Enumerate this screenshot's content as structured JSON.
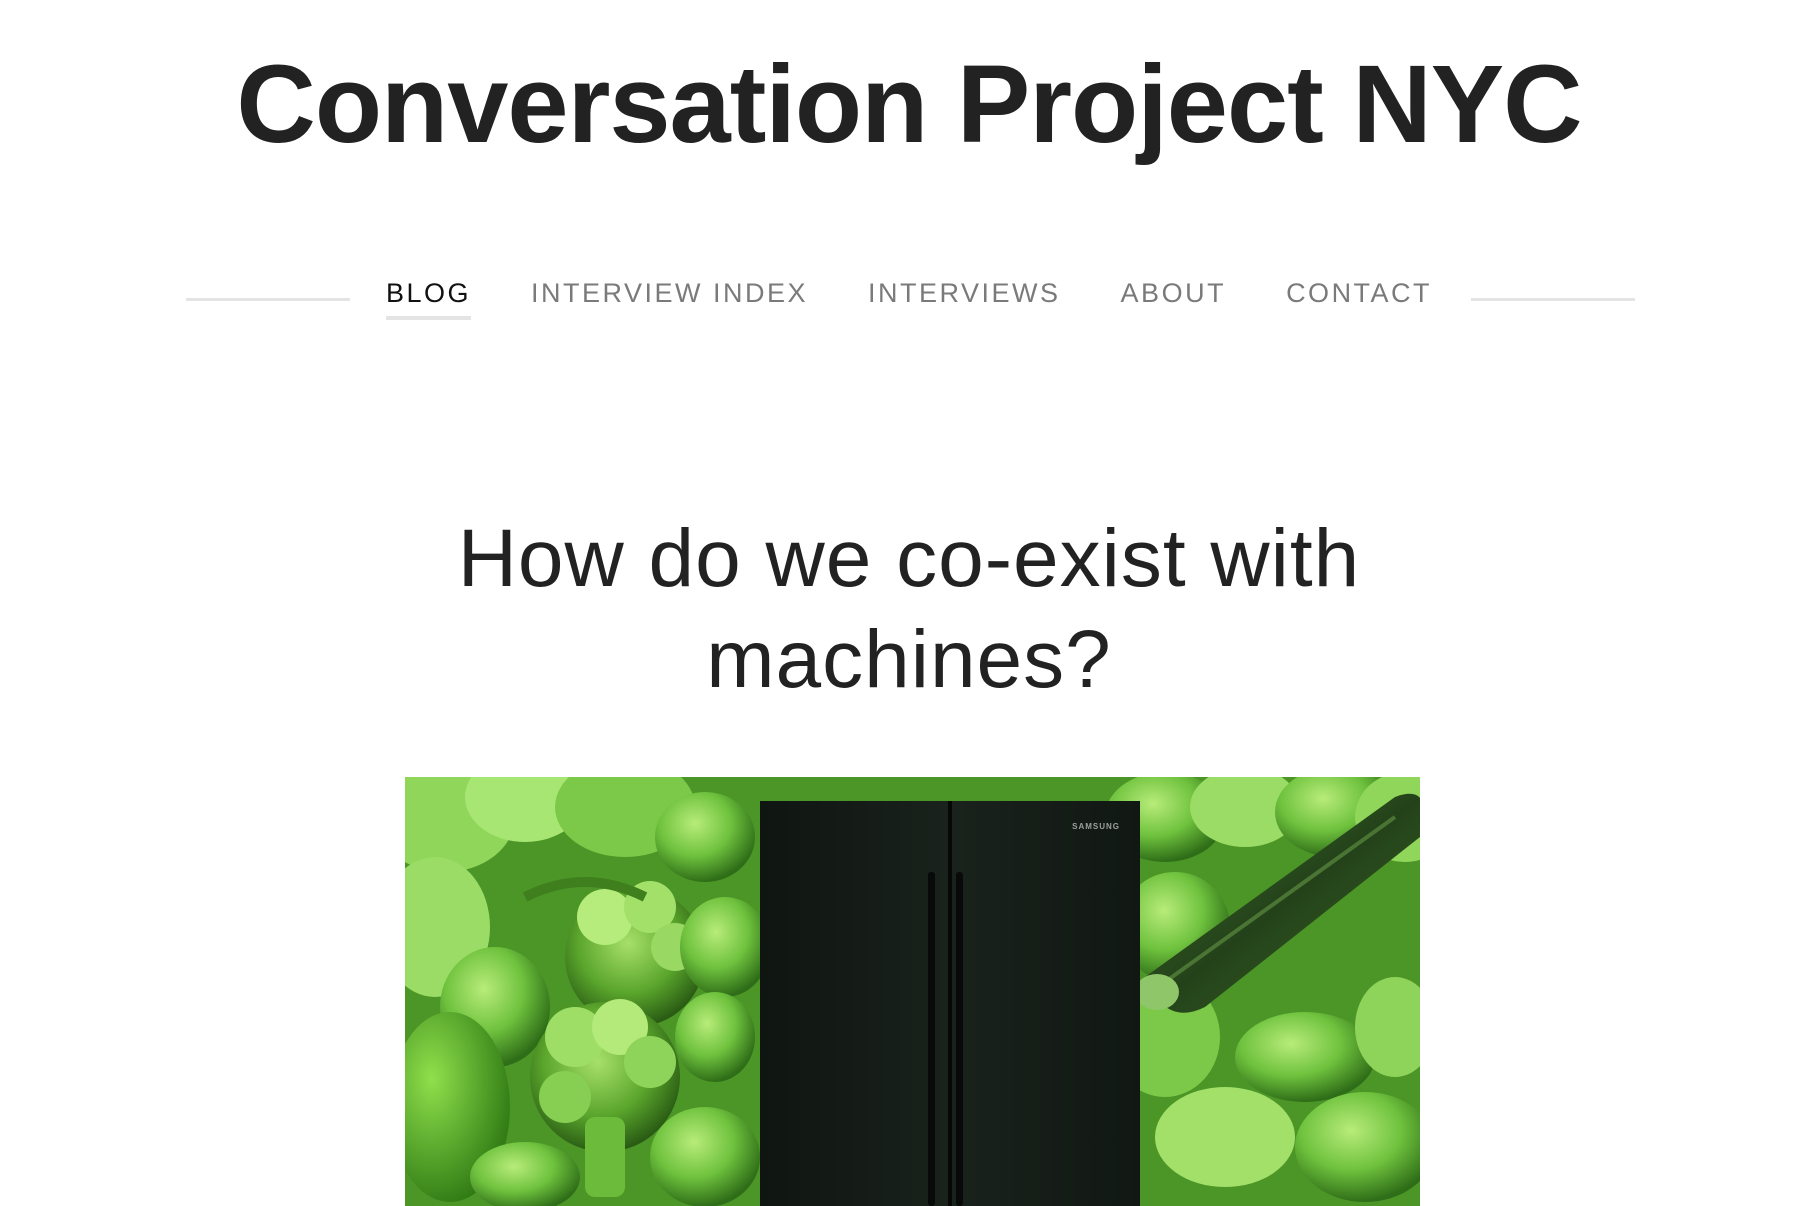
{
  "site": {
    "title": "Conversation Project NYC"
  },
  "nav": {
    "items": [
      {
        "label": "BLOG",
        "active": true
      },
      {
        "label": "INTERVIEW INDEX",
        "active": false
      },
      {
        "label": "INTERVIEWS",
        "active": false
      },
      {
        "label": "ABOUT",
        "active": false
      },
      {
        "label": "CONTACT",
        "active": false
      }
    ]
  },
  "post": {
    "title_line1": "How do we co-exist with",
    "title_line2": "machines?",
    "image": {
      "brand_text": "SAMSUNG"
    }
  },
  "colors": {
    "text": "#222222",
    "nav_inactive": "#7a7a7a",
    "nav_active": "#111111",
    "rule": "#e4e4e4",
    "vegetable_green": "#5fb536",
    "fridge": "#141a16"
  }
}
